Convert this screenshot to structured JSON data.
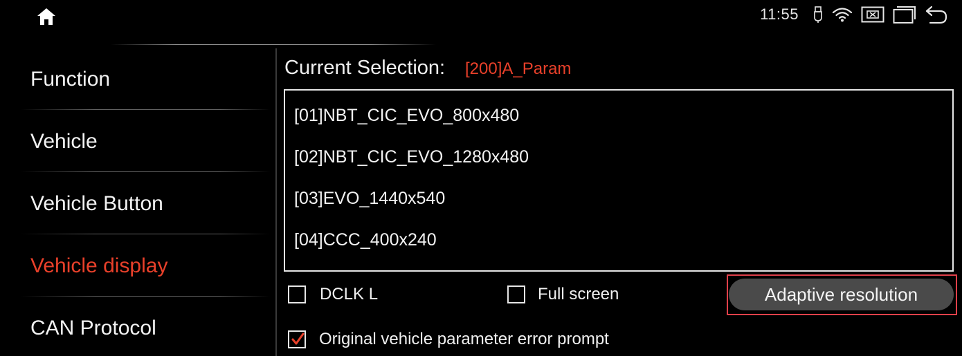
{
  "status_bar": {
    "time": "11:55",
    "icons": [
      "home-icon",
      "usb-icon",
      "wifi-icon",
      "close-screen-icon",
      "recent-apps-icon",
      "back-icon"
    ]
  },
  "sidebar": {
    "items": [
      {
        "label": "Function",
        "active": false
      },
      {
        "label": "Vehicle",
        "active": false
      },
      {
        "label": "Vehicle Button",
        "active": false
      },
      {
        "label": "Vehicle display",
        "active": true
      },
      {
        "label": "CAN Protocol",
        "active": false
      }
    ]
  },
  "main": {
    "selection_caption": "Current Selection:",
    "selection_value": "[200]A_Param",
    "list": [
      "[01]NBT_CIC_EVO_800x480",
      "[02]NBT_CIC_EVO_1280x480",
      "[03]EVO_1440x540",
      "[04]CCC_400x240"
    ],
    "options": {
      "dclk": {
        "label": "DCLK L",
        "checked": false
      },
      "full_screen": {
        "label": "Full screen",
        "checked": false
      },
      "error_prompt": {
        "label": "Original vehicle parameter error prompt",
        "checked": true
      }
    },
    "adaptive_button": "Adaptive resolution"
  },
  "colors": {
    "accent": "#e8402a",
    "highlight_border": "#e0404a",
    "button_bg": "#4a4a4a",
    "background": "#000000"
  }
}
